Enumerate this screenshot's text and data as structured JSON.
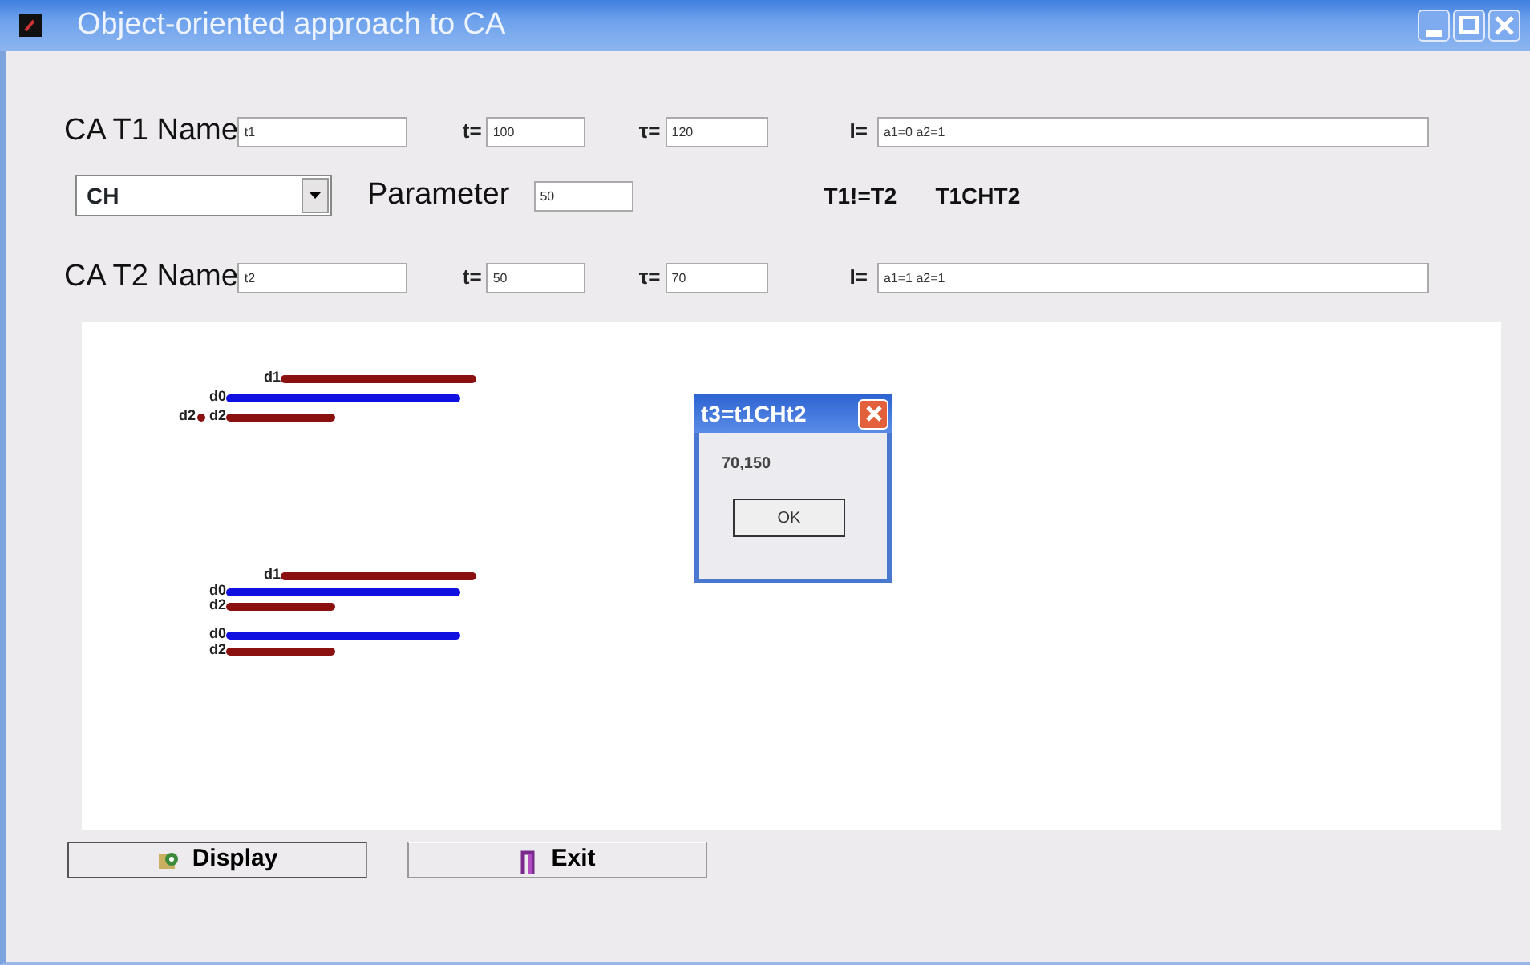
{
  "window": {
    "title": "Object-oriented approach to CA"
  },
  "t1": {
    "label": "CA T1 Name",
    "name": "t1",
    "t_label": "t=",
    "t": "100",
    "tau_label": "τ=",
    "tau": "120",
    "i_label": "I=",
    "i": "a1=0 a2=1"
  },
  "operator": {
    "value": "CH"
  },
  "parameter": {
    "label": "Parameter",
    "value": "50"
  },
  "results": [
    "T1!=T2",
    "T1CHT2"
  ],
  "t2": {
    "label": "CA T2 Name",
    "name": "t2",
    "t_label": "t=",
    "t": "50",
    "tau_label": "τ=",
    "tau": "70",
    "i_label": "I=",
    "i": "a1=1 a2=1"
  },
  "diagram": {
    "groups": [
      {
        "bars": [
          {
            "label": "d1",
            "kind": "long",
            "color": "#8b1010"
          },
          {
            "label": "d0",
            "kind": "mid",
            "color": "#1010e0"
          },
          {
            "label": "d2",
            "prefix": "d2",
            "kind": "short",
            "color": "#8b1010"
          }
        ]
      },
      {
        "bars": [
          {
            "label": "d1",
            "kind": "long",
            "color": "#8b1010"
          },
          {
            "label": "d0",
            "kind": "mid",
            "color": "#1010e0"
          },
          {
            "label": "d2",
            "kind": "short",
            "color": "#8b1010"
          }
        ]
      },
      {
        "bars": [
          {
            "label": "d0",
            "kind": "mid",
            "color": "#1010e0"
          },
          {
            "label": "d2",
            "kind": "short",
            "color": "#8b1010"
          }
        ]
      }
    ]
  },
  "dialog": {
    "title": "t3=t1CHt2",
    "message": "70,150",
    "button": "OK"
  },
  "buttons": [
    {
      "label": "Display",
      "kind": "display"
    },
    {
      "label": "Exit",
      "kind": "exit"
    }
  ]
}
